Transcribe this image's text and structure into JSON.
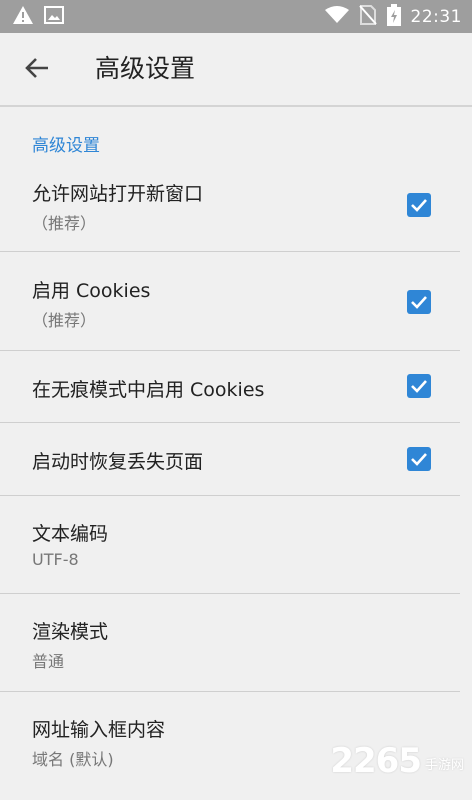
{
  "status_bar": {
    "time": "22:31",
    "icons": [
      "warning-icon",
      "image-icon",
      "wifi-icon",
      "no-sim-icon",
      "battery-charging-icon"
    ]
  },
  "toolbar": {
    "title": "高级设置",
    "back_icon": "arrow-back-icon"
  },
  "section": {
    "header": "高级设置"
  },
  "preferences": [
    {
      "title": "允许网站打开新窗口",
      "summary": "（推荐）",
      "checked": true
    },
    {
      "title": "启用 Cookies",
      "summary": "（推荐）",
      "checked": true
    },
    {
      "title": "在无痕模式中启用 Cookies",
      "summary": "",
      "checked": true
    },
    {
      "title": "启动时恢复丢失页面",
      "summary": "",
      "checked": true
    },
    {
      "title": "文本编码",
      "summary": "UTF-8"
    },
    {
      "title": "渲染模式",
      "summary": "普通"
    },
    {
      "title": "网址输入框内容",
      "summary": "域名 (默认)"
    }
  ],
  "watermark": {
    "number": "2265",
    "text": "手游网"
  },
  "colors": {
    "accent": "#2f86d6",
    "status_bar": "#9e9e9e",
    "background": "#f0f0f0"
  }
}
